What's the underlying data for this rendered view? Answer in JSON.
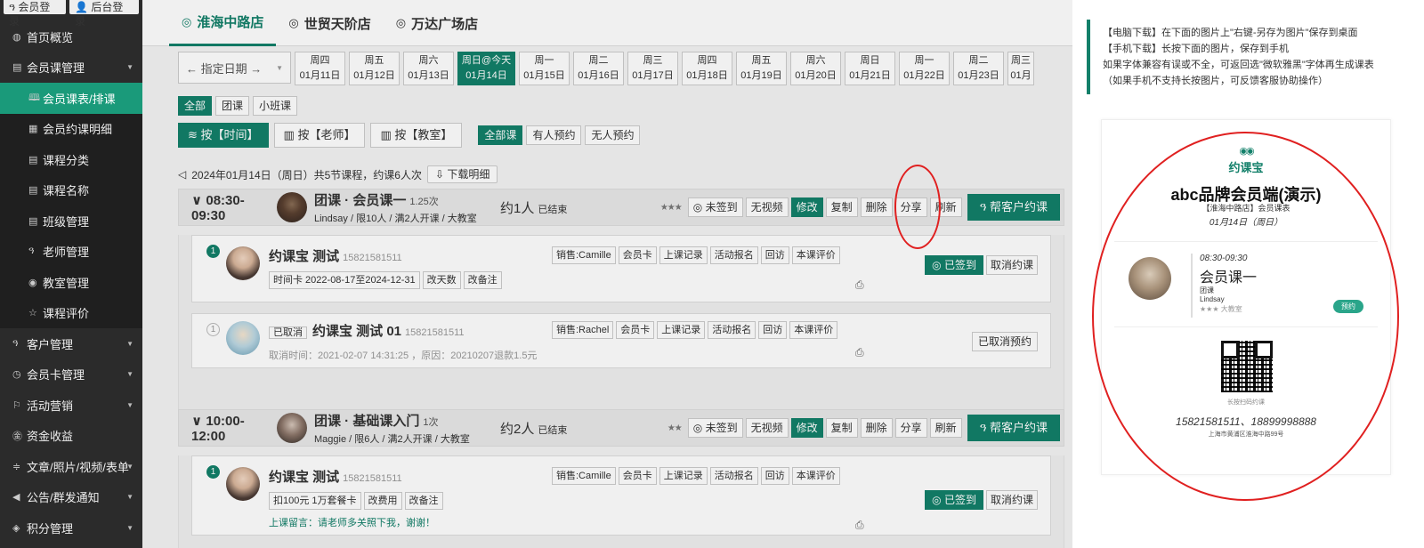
{
  "sidebar": {
    "top_buttons": [
      "会员登录",
      "后台登录"
    ],
    "items": [
      {
        "label": "首页概览",
        "icon": "globe-icon"
      },
      {
        "label": "会员课管理",
        "icon": "doc-icon",
        "expanded": true
      },
      {
        "label": "会员课表/排课",
        "sub": true,
        "active": true
      },
      {
        "label": "会员约课明细",
        "sub": true
      },
      {
        "label": "课程分类",
        "sub": true
      },
      {
        "label": "课程名称",
        "sub": true
      },
      {
        "label": "班级管理",
        "sub": true
      },
      {
        "label": "老师管理",
        "sub": true
      },
      {
        "label": "教室管理",
        "sub": true
      },
      {
        "label": "课程评价",
        "sub": true
      },
      {
        "label": "客户管理"
      },
      {
        "label": "会员卡管理"
      },
      {
        "label": "活动营销"
      },
      {
        "label": "资金收益"
      },
      {
        "label": "文章/照片/视频/表单"
      },
      {
        "label": "公告/群发通知"
      },
      {
        "label": "积分管理"
      }
    ]
  },
  "stores": [
    {
      "label": "淮海中路店",
      "active": true
    },
    {
      "label": "世贸天阶店"
    },
    {
      "label": "万达广场店"
    }
  ],
  "date_picker": {
    "label": "← 指定日期 →"
  },
  "dates": [
    {
      "week": "周四",
      "date": "01月11日"
    },
    {
      "week": "周五",
      "date": "01月12日"
    },
    {
      "week": "周六",
      "date": "01月13日"
    },
    {
      "week": "周日@今天",
      "date": "01月14日",
      "today": true
    },
    {
      "week": "周一",
      "date": "01月15日"
    },
    {
      "week": "周二",
      "date": "01月16日"
    },
    {
      "week": "周三",
      "date": "01月17日"
    },
    {
      "week": "周四",
      "date": "01月18日"
    },
    {
      "week": "周五",
      "date": "01月19日"
    },
    {
      "week": "周六",
      "date": "01月20日"
    },
    {
      "week": "周日",
      "date": "01月21日"
    },
    {
      "week": "周一",
      "date": "01月22日"
    },
    {
      "week": "周二",
      "date": "01月23日"
    },
    {
      "week": "周三",
      "date": "01月2"
    }
  ],
  "type_filters": [
    "全部",
    "团课",
    "小班课"
  ],
  "view_filters": [
    "按【时间】",
    "按【老师】",
    "按【教室】"
  ],
  "booking_filters": [
    "全部课",
    "有人预约",
    "无人预约"
  ],
  "summary": {
    "text": "2024年01月14日（周日）共5节课程，约课6人次",
    "download": "下载明细"
  },
  "slot_actions": [
    "未签到",
    "无视频",
    "修改",
    "复制",
    "删除",
    "分享",
    "刷新"
  ],
  "book_btn": "帮客户约课",
  "booking_ops": [
    "上课记录",
    "活动报名",
    "回访",
    "本课评价"
  ],
  "booking_labels": {
    "signed": "已签到",
    "cancel_btn": "取消约课",
    "cancelled_tag": "已取消",
    "cancelled_btn": "已取消预约"
  },
  "slots": [
    {
      "time": "08:30-09:30",
      "title": "团课 · 会员课一",
      "times": "1.25次",
      "sub": "Lindsay / 限10人 / 满2人开课 / 大教室",
      "count": "约1人",
      "status": "已结束",
      "stars": "★★★",
      "bookings": [
        {
          "num": "1",
          "name": "约课宝 测试",
          "phone": "15821581511",
          "sales": "销售:Camille",
          "card": "会员卡",
          "tags": [
            "时间卡 2022-08-17至2024-12-31",
            "改天数",
            "改备注"
          ]
        },
        {
          "num": "1",
          "name": "约课宝 测试 01",
          "phone": "15821581511",
          "sales": "销售:Rachel",
          "card": "会员卡",
          "note": "取消时间：2021-02-07 14:31:25 ，原因：20210207退款1.5元"
        }
      ]
    },
    {
      "time": "10:00-12:00",
      "title": "团课 · 基础课入门",
      "times": "1次",
      "sub": "Maggie / 限6人 / 满2人开课 / 大教室",
      "count": "约2人",
      "status": "已结束",
      "stars": "★★",
      "bookings": [
        {
          "num": "1",
          "name": "约课宝 测试",
          "phone": "15821581511",
          "sales": "销售:Camille",
          "card": "会员卡",
          "tags": [
            "扣100元 1万套餐卡",
            "改费用",
            "改备注"
          ],
          "note": "上课留言：请老师多关照下我，谢谢！"
        }
      ]
    }
  ],
  "panel": {
    "instr": [
      "【电脑下载】在下面的图片上\"右键-另存为图片\"保存到桌面",
      "【手机下载】长按下面的图片，保存到手机",
      "如果字体兼容有误或不全，可返回选\"微软雅黑\"字体再生成课表",
      "（如果手机不支持长按图片，可反馈客服协助操作）"
    ],
    "logo": "约课宝",
    "brand": "abc品牌会员端(演示)",
    "store": "【淮海中路店】会员课表",
    "date": "01月14日（周日）",
    "course_time": "08:30-09:30",
    "course_name": "会员课一",
    "course_type": "团课",
    "teacher": "Lindsay",
    "room": "大教室",
    "stars": "★★★",
    "book": "预约",
    "scan": "长按扫码约课",
    "phone": "15821581511、18899998888",
    "addr": "上海市黄浦区淮海中路99号"
  },
  "colors": {
    "accent": "#13806a",
    "sidebar": "#2b2b2b",
    "highlight": "#e02020"
  }
}
